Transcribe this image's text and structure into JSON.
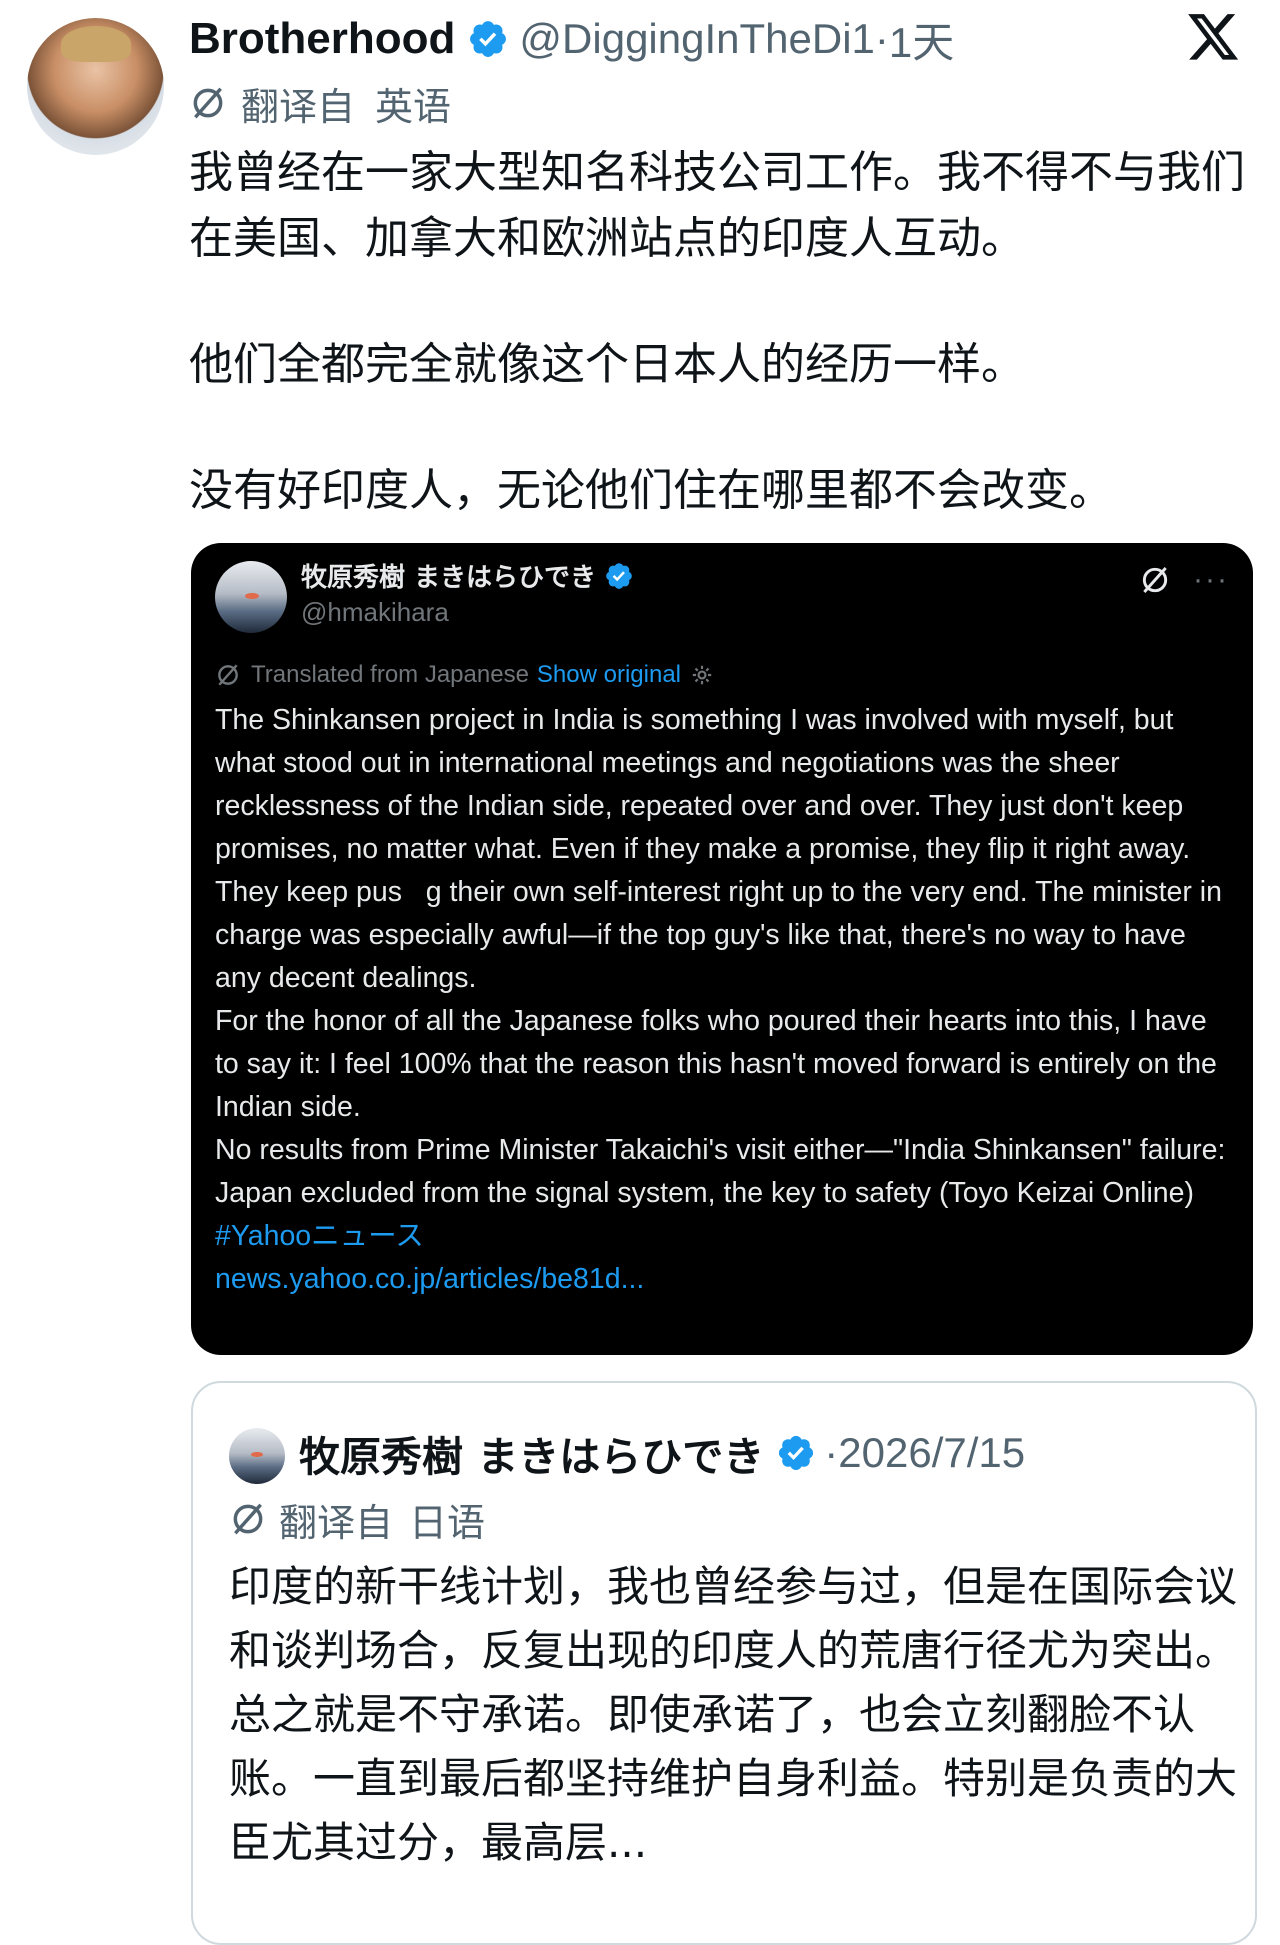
{
  "tweet": {
    "author_name": "Brotherhood",
    "handle": "@DiggingInTheDi1",
    "separator": "·",
    "time": "1天",
    "translated_label": "翻译自",
    "translated_lang": "英语",
    "paragraphs": [
      "我曾经在一家大型知名科技公司工作。我不得不与我们在美国、加拿大和欧洲站点的印度人互动。",
      "他们全都完全就像这个日本人的经历一样。",
      "没有好印度人，无论他们住在哪里都不会改变。"
    ]
  },
  "embedded_screenshot": {
    "author_name": "牧原秀樹 まきはらひでき",
    "handle": "@hmakihara",
    "translated_from": "Translated from Japanese",
    "show_original": "Show original",
    "more": "···",
    "paragraphs": [
      "The Shinkansen project in India is something I was involved with myself, but what stood out in international meetings and negotiations was the sheer recklessness of the Indian side, repeated over and over. They just don't keep promises, no matter what. Even if they make a promise, they flip it right away. They keep pus   g their own self-interest right up to the very end. The minister in charge was especially awful—if the top guy's like that, there's no way to have any decent dealings.",
      "For the honor of all the Japanese folks who poured their hearts into this, I have to say it: I feel 100% that the reason this hasn't moved forward is entirely on the Indian side.",
      "No results from Prime Minister Takaichi's visit either—\"India Shinkansen\" failure: Japan excluded from the signal system, the key to safety (Toyo Keizai Online)"
    ],
    "hashtag": "#Yahooニュース",
    "link": "news.yahoo.co.jp/articles/be81d..."
  },
  "quote": {
    "author_name": "牧原秀樹 まきはらひでき",
    "separator": "·",
    "date": "2026/7/15",
    "translated_label": "翻译自",
    "translated_lang": "日语",
    "text": "印度的新干线计划，我也曾经参与过，但是在国际会议和谈判场合，反复出现的印度人的荒唐行径尤为突出。总之就是不守承诺。即使承诺了，也会立刻翻脸不认账。一直到最后都坚持维护自身利益。特别是负责的大臣尤其过分，最高层..."
  },
  "icons": {
    "verified": "verified-badge-icon",
    "x_logo": "x-logo-icon",
    "translate": "translate-icon",
    "gear": "gear-icon",
    "more": "more-icon"
  },
  "colors": {
    "accent": "#1d9bf0",
    "text": "#0f1419",
    "muted": "#536471",
    "card_dark": "#000000",
    "border": "#cfd9de"
  }
}
